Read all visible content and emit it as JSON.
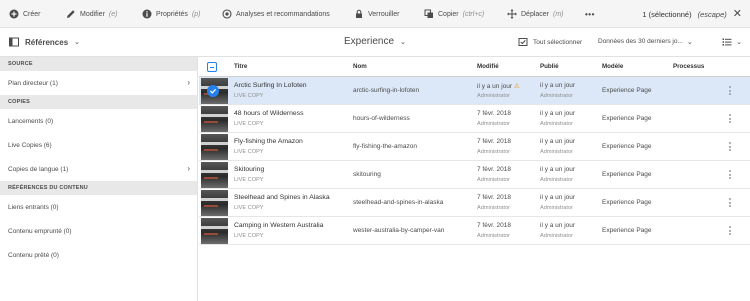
{
  "actionbar": {
    "create": "Créer",
    "edit": "Modifier",
    "edit_shortcut": "(e)",
    "properties": "Propriétés",
    "properties_shortcut": "(p)",
    "analytics": "Analyses et recommandations",
    "lock": "Verrouiller",
    "copy": "Copier",
    "copy_shortcut": "(ctrl+c)",
    "move": "Déplacer",
    "move_shortcut": "(m)",
    "more": "•••",
    "selection_count": "1 (sélectionné)",
    "escape": "(escape)",
    "close": "✕"
  },
  "rail": {
    "title": "Références",
    "sections": [
      {
        "header": "SOURCE",
        "items": [
          {
            "label": "Plan directeur (1)",
            "arrow": "›"
          }
        ]
      },
      {
        "header": "COPIES",
        "items": [
          {
            "label": "Lancements (0)",
            "arrow": ""
          },
          {
            "label": "Live Copies (6)",
            "arrow": ""
          },
          {
            "label": "Copies de langue (1)",
            "arrow": "›"
          }
        ]
      },
      {
        "header": "RÉFÉRENCES DU CONTENU",
        "items": [
          {
            "label": "Liens entrants (0)",
            "arrow": ""
          },
          {
            "label": "Contenu emprunté (0)",
            "arrow": ""
          },
          {
            "label": "Contenu prêté (0)",
            "arrow": ""
          }
        ]
      }
    ]
  },
  "content": {
    "title": "Experience",
    "select_all": "Tout sélectionner",
    "period": "Données des 30 derniers jo...",
    "columns": {
      "title": "Titre",
      "name": "Nom",
      "modified": "Modifié",
      "published": "Publié",
      "model": "Modèle",
      "process": "Processus"
    },
    "rows": [
      {
        "title": "Arctic Surfing In Lofoten",
        "sub": "LIVE COPY",
        "name": "arctic-surfing-in-lofoten",
        "modified": "il y a un jour",
        "modified_by": "Administrator",
        "modified_warning": true,
        "published": "il y a un jour",
        "published_by": "Administrator",
        "model": "Experience Page",
        "selected": true
      },
      {
        "title": "48 hours of Wilderness",
        "sub": "LIVE COPY",
        "name": "hours-of-wilderness",
        "modified": "7 févr. 2018",
        "modified_by": "Administrator",
        "modified_warning": false,
        "published": "il y a un jour",
        "published_by": "Administrator",
        "model": "Experience Page",
        "selected": false
      },
      {
        "title": "Fly-fishing the Amazon",
        "sub": "LIVE COPY",
        "name": "fly-fishing-the-amazon",
        "modified": "7 févr. 2018",
        "modified_by": "Administrator",
        "modified_warning": false,
        "published": "il y a un jour",
        "published_by": "Administrator",
        "model": "Experience Page",
        "selected": false
      },
      {
        "title": "Skitouring",
        "sub": "LIVE COPY",
        "name": "skitouring",
        "modified": "7 févr. 2018",
        "modified_by": "Administrator",
        "modified_warning": false,
        "published": "il y a un jour",
        "published_by": "Administrator",
        "model": "Experience Page",
        "selected": false
      },
      {
        "title": "Steelhead and Spines in Alaska",
        "sub": "LIVE COPY",
        "name": "steelhead-and-spines-in-alaska",
        "modified": "7 févr. 2018",
        "modified_by": "Administrator",
        "modified_warning": false,
        "published": "il y a un jour",
        "published_by": "Administrator",
        "model": "Experience Page",
        "selected": false
      },
      {
        "title": "Camping in Western Australia",
        "sub": "LIVE COPY",
        "name": "wester-australia-by-camper-van",
        "modified": "7 févr. 2018",
        "modified_by": "Administrator",
        "modified_warning": false,
        "published": "il y a un jour",
        "published_by": "Administrator",
        "model": "Experience Page",
        "selected": false
      }
    ]
  },
  "colors": {
    "accent": "#2680eb",
    "selected_row": "#dce8f8",
    "warning": "#e68619",
    "section_bg": "#e8e8e8",
    "toolbar_bg": "#f5f5f5"
  },
  "icons": [
    "plus-icon",
    "pencil-icon",
    "info-icon",
    "analytics-icon",
    "lock-icon",
    "copy-icon",
    "move-icon",
    "more-icon",
    "close-icon",
    "rail-icon",
    "chevron-down-icon",
    "select-all-icon",
    "list-view-icon",
    "checkmark-icon",
    "alert-icon",
    "more-vertical-icon",
    "chevron-right-icon"
  ]
}
